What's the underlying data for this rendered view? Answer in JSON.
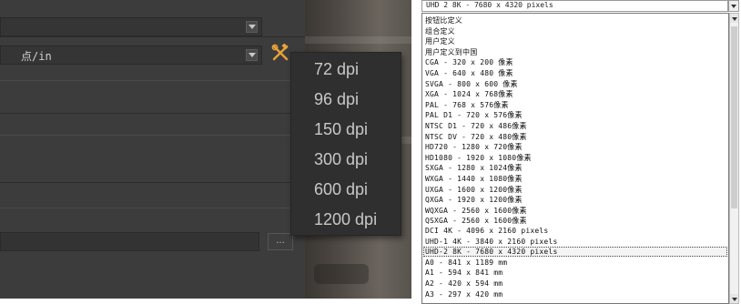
{
  "left_panel": {
    "units_combo_value": "点/in",
    "browse_label": "..."
  },
  "dpi_menu": {
    "options": [
      "72 dpi",
      "96 dpi",
      "150 dpi",
      "300 dpi",
      "600 dpi",
      "1200 dpi"
    ]
  },
  "size_list": {
    "combo_value": "UHD 2 8K - 7680 x 4320 pixels",
    "items": [
      "按钮比定义",
      "组合定义",
      "用户定义",
      "用户定义到中国",
      "CGA - 320 x 200 像素",
      "VGA - 640 x 480 像素",
      "SVGA - 800 x 600 像素",
      "XGA - 1024 x 768像素",
      "PAL - 768 x 576像素",
      "PAL D1 - 720 x 576像素",
      "NTSC D1 - 720 x 486像素",
      "NTSC DV - 720 x 480像素",
      "HD720 - 1280 x 720像素",
      "HD1080 - 1920 x 1080像素",
      "SXGA - 1280 x 1024像素",
      "WXGA - 1440 x 1080像素",
      "UXGA - 1600 x 1200像素",
      "QXGA - 1920 x 1200像素",
      "WQXGA - 2560 x 1600像素",
      "QSXGA - 2560 x 1600像素",
      "DCI 4K - 4096 x 2160 pixels",
      "UHD-1 4K - 3840 x 2160 pixels",
      "UHD-2 8K - 7680 x 4320 pixels",
      "A0 - 841 x 1189 mm",
      "A1 - 594 x 841 mm",
      "A2 - 420 x 594 mm",
      "A3 - 297 x 420 mm"
    ],
    "selected_index": 22
  }
}
